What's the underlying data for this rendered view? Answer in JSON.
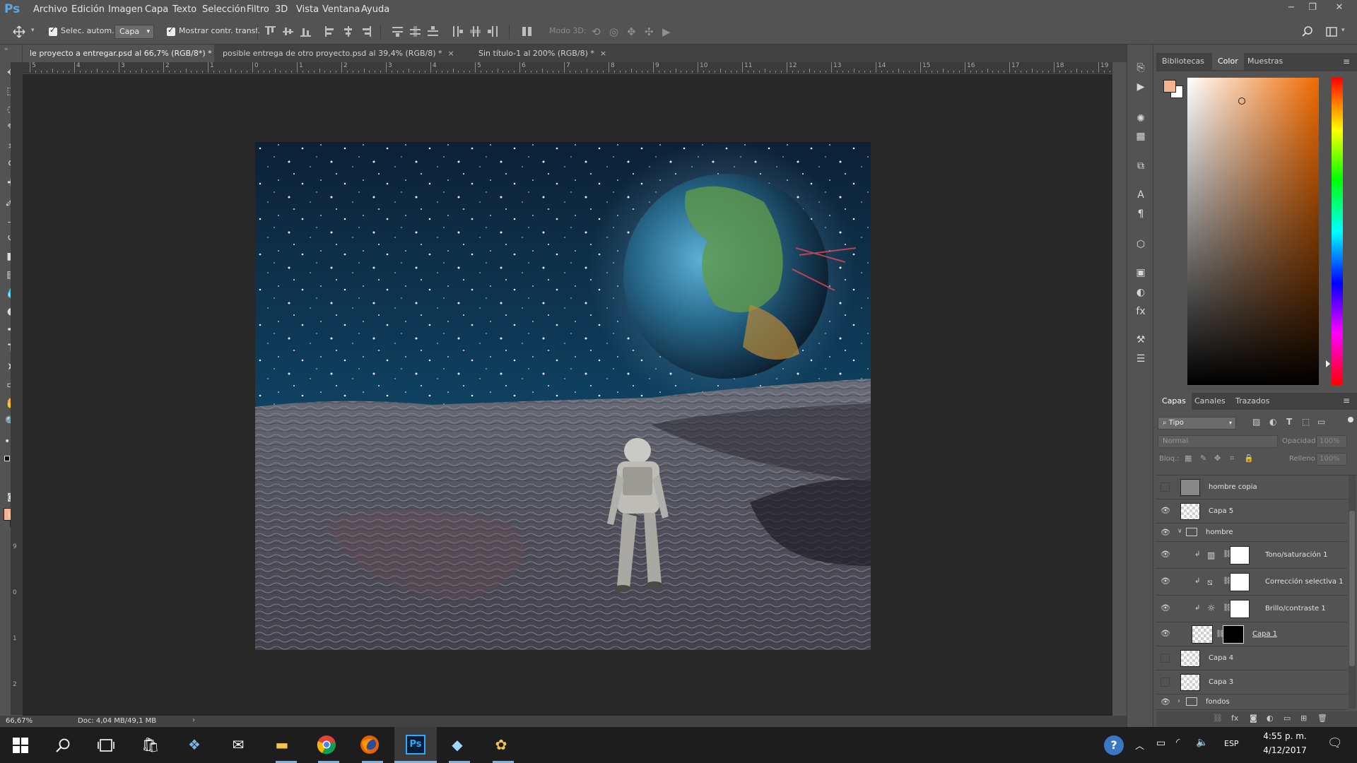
{
  "app": {
    "logo": "Ps"
  },
  "menu": [
    "Archivo",
    "Edición",
    "Imagen",
    "Capa",
    "Texto",
    "Selección",
    "Filtro",
    "3D",
    "Vista",
    "Ventana",
    "Ayuda"
  ],
  "window_controls": [
    "−",
    "❐",
    "✕"
  ],
  "options": {
    "auto_select_label": "Selec. autom.:",
    "auto_select_value": "Capa",
    "show_transform_label": "Mostrar contr. transf.",
    "mode3d_label": "Modo 3D:"
  },
  "tabs": [
    {
      "label": "le proyecto a entregar.psd al 66,7% (RGB/8*) *",
      "active": true
    },
    {
      "label": "posible entrega de otro proyecto.psd al 39,4% (RGB/8) *",
      "active": false
    },
    {
      "label": "Sin título-1 al 200% (RGB/8) *",
      "active": false
    }
  ],
  "tab_close": "×",
  "ruler_top": [
    "5",
    "4",
    "3",
    "2",
    "1",
    "0",
    "1",
    "2",
    "3",
    "4",
    "5",
    "6",
    "7",
    "8",
    "9",
    "10",
    "11",
    "12",
    "13",
    "14",
    "15",
    "16",
    "17",
    "18",
    "19"
  ],
  "ruler_left": [
    "9",
    "0",
    "1",
    "2"
  ],
  "status": {
    "zoom": "66,67%",
    "doc": "Doc: 4,04 MB/49,1 MB",
    "arrow": "›"
  },
  "color_panel": {
    "tabs": [
      "Bibliotecas",
      "Color",
      "Muestras"
    ],
    "active_tab": "Color",
    "foreground": "#f2b48f",
    "background": "#ffffff"
  },
  "layers_panel": {
    "tabs": [
      "Capas",
      "Canales",
      "Trazados"
    ],
    "active_tab": "Capas",
    "filter_kind": "Tipo",
    "blend_mode": "Normal",
    "opacity_label": "Opacidad:",
    "opacity_value": "100%",
    "lock_label": "Bloq.:",
    "fill_label": "Relleno:",
    "fill_value": "100%",
    "layers": [
      {
        "name": "hombre copia",
        "visible": false,
        "type": "layer",
        "indent": 0
      },
      {
        "name": "Capa 5",
        "visible": true,
        "type": "layer",
        "indent": 0
      },
      {
        "name": "hombre",
        "visible": true,
        "type": "folder",
        "indent": 0
      },
      {
        "name": "Tono/saturación 1",
        "visible": true,
        "type": "adjustment",
        "indent": 1
      },
      {
        "name": "Corrección selectiva 1",
        "visible": true,
        "type": "adjustment",
        "indent": 1
      },
      {
        "name": "Brillo/contraste 1",
        "visible": true,
        "type": "adjustment",
        "indent": 1
      },
      {
        "name": "Capa 1",
        "visible": true,
        "type": "masked",
        "indent": 1
      },
      {
        "name": "Capa 4",
        "visible": false,
        "type": "layer",
        "indent": 0
      },
      {
        "name": "Capa 3",
        "visible": false,
        "type": "layer",
        "indent": 0
      },
      {
        "name": "fondos",
        "visible": true,
        "type": "folder",
        "indent": 0
      }
    ]
  },
  "taskbar": {
    "time": "4:55 p. m.",
    "date": "4/12/2017",
    "language": "ESP"
  }
}
